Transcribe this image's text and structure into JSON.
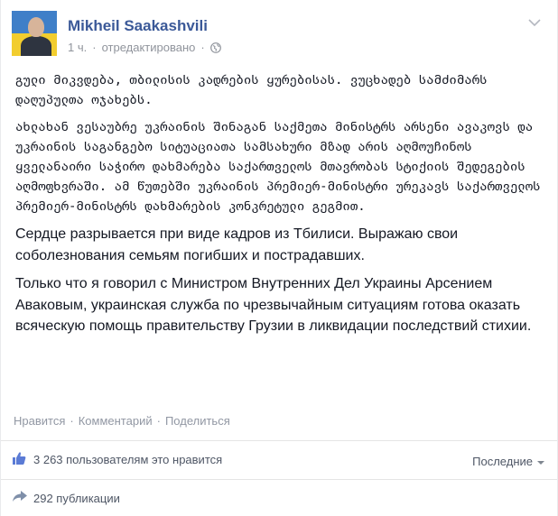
{
  "post": {
    "author": "Mikheil Saakashvili",
    "time": "1 ч.",
    "separator": "·",
    "edited": "отредактировано",
    "paragraphs": {
      "ka_1": "გული მიკვდება, თბილისის კადრების ყურებისას. ვუცხადებ სამძიმარს დაღუპულთა ოჯახებს.",
      "ka_2": "ახლახან ვესაუბრე უკრაინის შინაგან საქმეთა მინისტრს არსენი ავაკოვს და უკრაინის საგანგებო სიტუაციათა სამსახური მზად არის აღმოუჩინოს ყველანაირი საჭირო დახმარება საქართველოს მთავრობას სტიქიის შედეგების აღმოფხვრაში. ამ წუთებში უკრაინის პრემიერ-მინისტრი ურეკავს საქართველოს პრემიერ-მინისტრს დახმარების კონკრეტული გეგმით.",
      "ru_1": "Сердце разрывается при виде кадров из Тбилиси. Выражаю свои соболезнования семьям погибших и пострадавших.",
      "ru_2": "Только что я говорил с Министром Внутренних Дел Украины Арсением Аваковым, украинская служба по чрезвычайным ситуациям готова оказать всяческую помощь правительству Грузии в ликвидации последствий стихии."
    },
    "actions": {
      "like": "Нравится",
      "comment": "Комментарий",
      "share": "Поделиться",
      "sep": "·"
    },
    "likes_text": "3 263 пользователям это нравится",
    "sort_label": "Последние",
    "shares_text": "292 публикации"
  },
  "colors": {
    "link": "#3b5998",
    "meta": "#90949c",
    "text": "#141823"
  },
  "icons": [
    "globe-icon",
    "chevron-down-icon",
    "like-icon",
    "share-icon"
  ]
}
